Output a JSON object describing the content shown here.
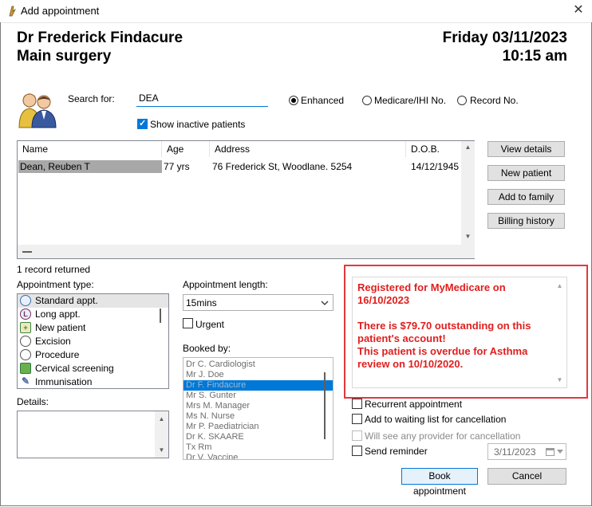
{
  "window": {
    "title": "Add appointment",
    "close_glyph": "✕",
    "icon": "app-icon"
  },
  "header": {
    "doctor": "Dr Frederick Findacure",
    "location": "Main surgery",
    "date": "Friday 03/11/2023",
    "time": "10:15 am"
  },
  "search": {
    "label": "Search for:",
    "value": "DEA",
    "options": [
      "Enhanced",
      "Medicare/IHI No.",
      "Record No."
    ],
    "selected_option": "Enhanced",
    "show_inactive_label": "Show inactive patients",
    "show_inactive_checked": true
  },
  "results": {
    "columns": [
      "Name",
      "Age",
      "Address",
      "D.O.B."
    ],
    "rows": [
      {
        "name": "Dean, Reuben T",
        "age": "77 yrs",
        "address": "76 Frederick St, Woodlane. 5254",
        "dob": "14/12/1945"
      }
    ],
    "count_text": "1 record returned"
  },
  "side_buttons": {
    "view_details": "View details",
    "new_patient": "New patient",
    "add_to_family": "Add to family",
    "billing_history": "Billing history"
  },
  "appointment_type": {
    "label": "Appointment type:",
    "items": [
      "Standard appt.",
      "Long appt.",
      "New patient",
      "Excision",
      "Procedure",
      "Cervical screening",
      "Immunisation"
    ],
    "selected": "Standard appt."
  },
  "appointment_length": {
    "label": "Appointment length:",
    "value": "15mins"
  },
  "urgent": {
    "label": "Urgent",
    "checked": false
  },
  "booked_by": {
    "label": "Booked by:",
    "items": [
      "Dr C. Cardiologist",
      "Mr J. Doe",
      "Dr F. Findacure",
      "Mr S. Gunter",
      "Mrs M. Manager",
      "Ms N. Nurse",
      "Mr P. Paediatrician",
      "Dr K. SKAARE",
      "Tx Rm",
      "Dr V. Vaccine"
    ],
    "selected": "Dr F. Findacure"
  },
  "details": {
    "label": "Details:",
    "value": ""
  },
  "alert": {
    "line1": "Registered for MyMedicare on",
    "line2": "16/10/2023",
    "line3": "There is $79.70 outstanding on this",
    "line4": "patient's account!",
    "line5": "This patient is overdue for Asthma",
    "line6": "review on 10/10/2020.",
    "color": "#e01e1e"
  },
  "options": {
    "recurrent": {
      "label": "Recurrent appointment",
      "checked": false
    },
    "waiting_list": {
      "label": "Add to waiting list for cancellation",
      "checked": false
    },
    "any_provider": {
      "label": "Will see any provider for cancellation",
      "checked": false,
      "disabled": true
    },
    "send_reminder": {
      "label": "Send reminder",
      "checked": false
    },
    "reminder_date": "3/11/2023"
  },
  "actions": {
    "book": "Book appointment",
    "cancel": "Cancel"
  },
  "colors": {
    "accent": "#0078d7",
    "alert_border": "#e0393e",
    "row_highlight": "#a8a8a8"
  }
}
